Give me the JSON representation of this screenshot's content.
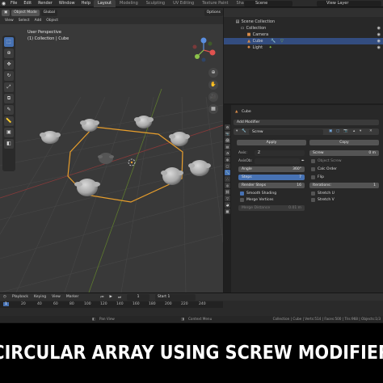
{
  "topbar": {
    "menus": [
      "File",
      "Edit",
      "Render",
      "Window",
      "Help"
    ],
    "workspaces": [
      "Layout",
      "Modeling",
      "Sculpting",
      "UV Editing",
      "Texture Paint",
      "Shading"
    ],
    "active_workspace": "Layout",
    "scene": "Scene",
    "view_layer": "View Layer"
  },
  "viewport": {
    "mode": "Object Mode",
    "menus": [
      "View",
      "Select",
      "Add",
      "Object"
    ],
    "transform": "Global",
    "options": "Options",
    "perspective_label": "User Perspective",
    "collection_label": "(1) Collection | Cube"
  },
  "outliner": {
    "root": "Scene Collection",
    "items": [
      {
        "name": "Collection",
        "icon": "collection-icon",
        "selected": false
      },
      {
        "name": "Camera",
        "icon": "camera-icon",
        "selected": false
      },
      {
        "name": "Cube",
        "icon": "mesh-icon",
        "selected": true
      },
      {
        "name": "Light",
        "icon": "light-icon",
        "selected": false
      }
    ]
  },
  "properties": {
    "object_name": "Cube",
    "add_modifier": "Add Modifier",
    "modifier_name": "Screw",
    "apply": "Apply",
    "copy": "Copy",
    "axis_label": "Axis:",
    "axis_value": "Z",
    "axis_ob_label": "AxisOb:",
    "screw_label": "Screw",
    "screw_value": "0 m",
    "angle_label": "Angle",
    "angle_value": "360°",
    "steps_label": "Steps",
    "steps_value": "7",
    "render_steps_label": "Render Steps",
    "render_steps_value": "16",
    "iterations_label": "Iterations:",
    "iterations_value": "1",
    "object_screw": "Object Screw",
    "calc_order": "Calc Order",
    "flip": "Flip",
    "smooth_shading": "Smooth Shading",
    "merge_vertices": "Merge Vertices",
    "merge_distance_label": "Merge Distance",
    "merge_distance_value": "0.01 m",
    "stretch_u": "Stretch U",
    "stretch_v": "Stretch V"
  },
  "timeline": {
    "menus": [
      "Playback",
      "Keying",
      "View",
      "Marker"
    ],
    "current_frame": "1",
    "start_label": "Start",
    "start_value": "1",
    "ruler": [
      "1",
      "20",
      "40",
      "60",
      "80",
      "100",
      "120",
      "140",
      "160",
      "180",
      "200",
      "220",
      "240"
    ]
  },
  "status": {
    "pan_view": "Pan View",
    "context_menu": "Context Menu",
    "stats": "Collection | Cube | Verts:514 | Faces:500 | Tris:968 | Objects:1/3"
  },
  "caption": "CIRCULAR ARRAY USING SCREW MODIFIER",
  "colors": {
    "accent": "#4772b3",
    "selection_outline": "#e89e2c",
    "caption_bg": "#000000"
  }
}
